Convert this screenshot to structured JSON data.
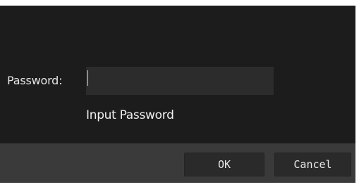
{
  "dialog": {
    "password_label": "Password:",
    "password_value": "",
    "password_hint": "Input Password",
    "ok_label": "OK",
    "cancel_label": "Cancel"
  },
  "colors": {
    "content_background": "#1c1c1c",
    "input_background": "#2c2c2c",
    "footer_background": "#3a3a3a",
    "button_background": "#2a2a2a",
    "text": "#e6e6e6"
  }
}
